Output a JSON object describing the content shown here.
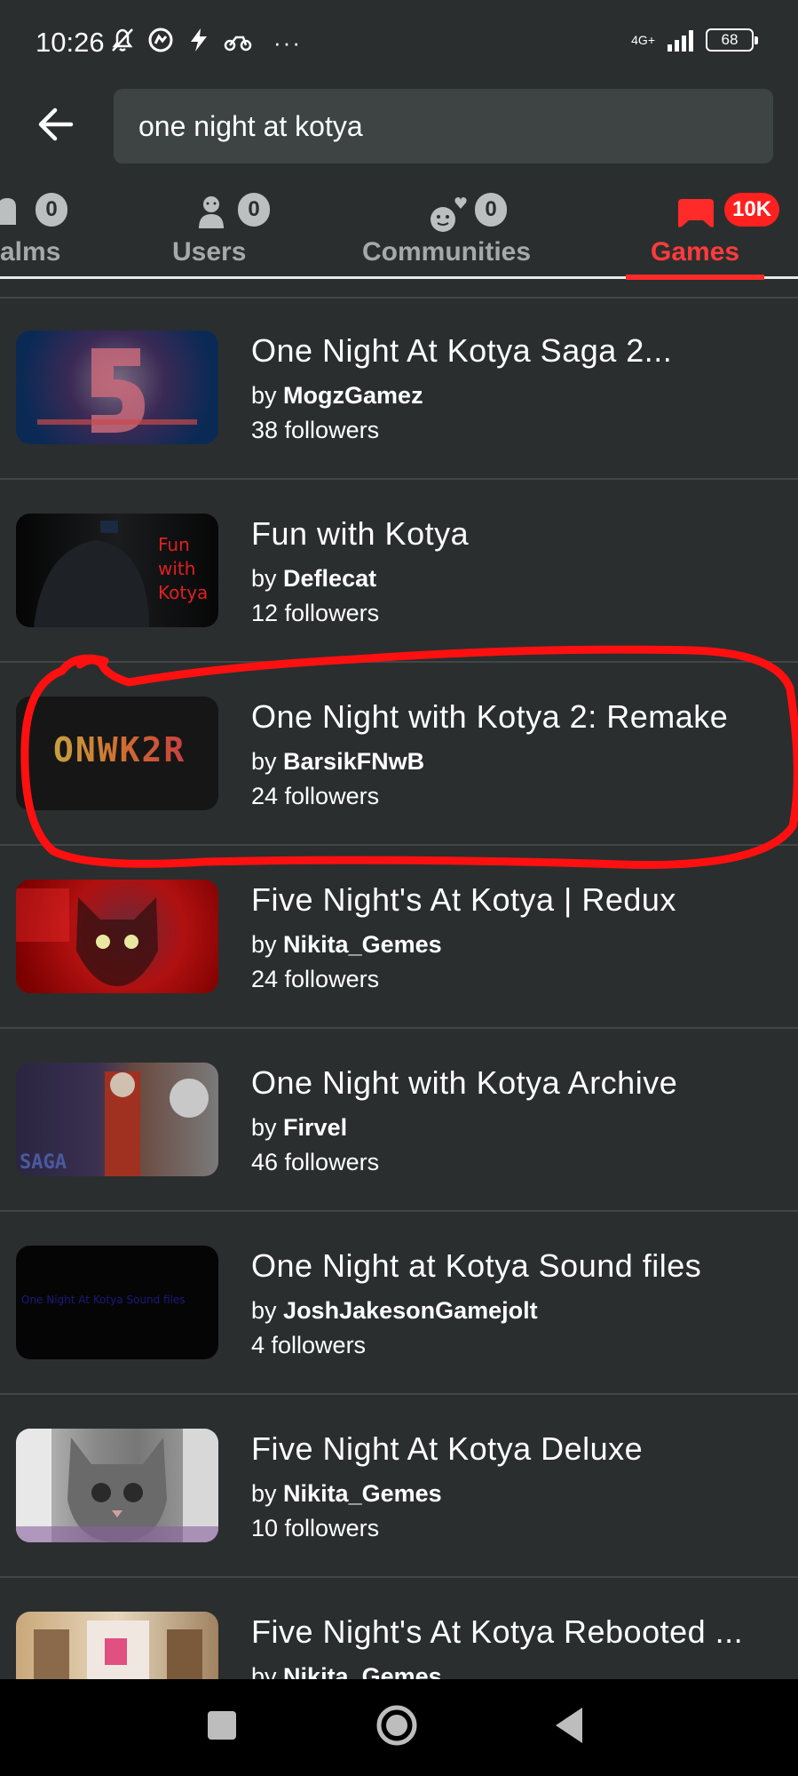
{
  "status_bar": {
    "time": "10:26",
    "network": "4G+",
    "battery": "68",
    "more": "···"
  },
  "search": {
    "query": "one night at kotya",
    "back_icon": "arrow-left-icon"
  },
  "tabs": [
    {
      "label": "alms",
      "count": "0",
      "icon": "realm-icon"
    },
    {
      "label": "Users",
      "count": "0",
      "icon": "user-icon"
    },
    {
      "label": "Communities",
      "count": "0",
      "icon": "community-icon"
    },
    {
      "label": "Games",
      "count": "10K",
      "icon": "gamepad-icon",
      "active": true
    }
  ],
  "results": [
    {
      "title": "One Night At Kotya Saga 2...",
      "by": "by",
      "author": "MogzGamez",
      "followers": "38 followers"
    },
    {
      "title": "Fun with Kotya",
      "by": "by",
      "author": "Deflecat",
      "followers": "12 followers",
      "thumb_text": "Fun\nwith\nKotya"
    },
    {
      "title": "One Night with Kotya 2: Remake",
      "by": "by",
      "author": "BarsikFNwB",
      "followers": "24 followers",
      "thumb_text": "ONWK2R"
    },
    {
      "title": "Five Night's At Kotya | Redux",
      "by": "by",
      "author": "Nikita_Gemes",
      "followers": "24 followers"
    },
    {
      "title": "One Night with Kotya Archive",
      "by": "by",
      "author": "Firvel",
      "followers": "46 followers",
      "thumb_text": "SAGA"
    },
    {
      "title": "One Night at Kotya Sound files",
      "by": "by",
      "author": "JoshJakesonGamejolt",
      "followers": "4 followers",
      "thumb_text": "One Night At Kotya Sound files"
    },
    {
      "title": "Five Night At Kotya Deluxe",
      "by": "by",
      "author": "Nikita_Gemes",
      "followers": "10 followers"
    },
    {
      "title": "Five Night's At Kotya Rebooted ...",
      "by": "by",
      "author": "Nikita_Gemes",
      "followers": ""
    }
  ],
  "colors": {
    "background": "#2b2e2e",
    "accent": "#ff2a2a",
    "search_bg": "#3d4443"
  },
  "nav": {
    "recent_icon": "square-icon",
    "home_icon": "circle-icon",
    "back_icon": "triangle-back-icon"
  }
}
